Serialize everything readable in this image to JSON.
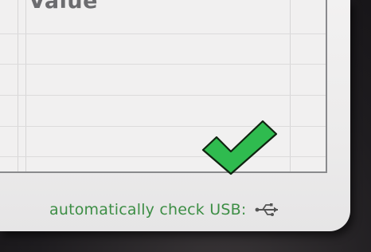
{
  "table": {
    "column_header": "Value"
  },
  "status": {
    "ok_icon": "checkmark-icon",
    "usb_label": "automatically check USB:",
    "usb_icon": "usb-icon"
  },
  "colors": {
    "check_fill": "#2fbb4f",
    "check_stroke": "#0f2410",
    "label_text": "#3d8e45"
  }
}
